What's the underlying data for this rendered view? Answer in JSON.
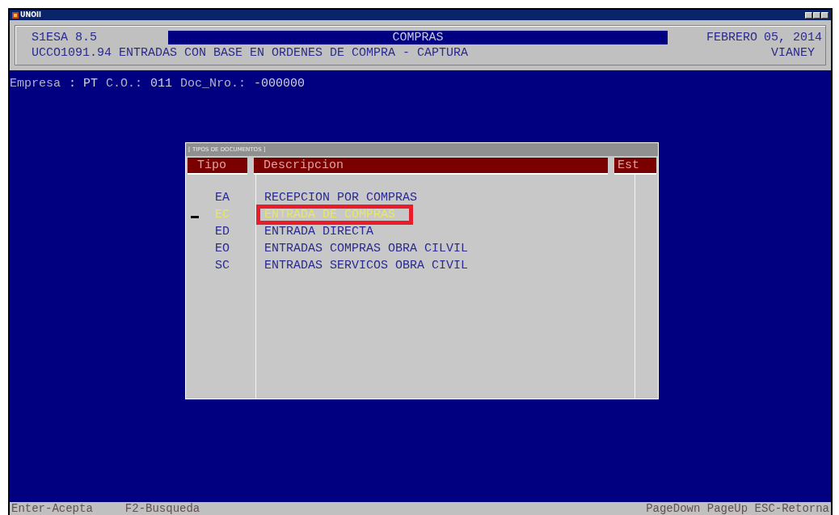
{
  "window": {
    "title": "UNOII"
  },
  "header": {
    "product": "S1ESA 8.5",
    "module": "COMPRAS",
    "date_month": "FEBRERO",
    "date_day": "05, 2014",
    "program": "UCCO1091.94 ENTRADAS CON BASE EN ORDENES DE COMPRA - CAPTURA",
    "user": "VIANEY"
  },
  "fields": [
    {
      "label": "Empresa",
      "value": ": PT"
    },
    {
      "label": "C.O.:",
      "value": "011"
    },
    {
      "label": "Doc_Nro.:",
      "value": "-000000"
    }
  ],
  "dialog": {
    "title": "[ TIPOS DE DOCUMENTOS ]",
    "columns": [
      "Tipo",
      "Descripcion",
      "Est"
    ],
    "rows": [
      {
        "tipo": "EA",
        "descripcion": "RECEPCION POR COMPRAS",
        "selected": false
      },
      {
        "tipo": "EC",
        "descripcion": "ENTRADA DE COMPRAS",
        "selected": true
      },
      {
        "tipo": "ED",
        "descripcion": "ENTRADA DIRECTA",
        "selected": false
      },
      {
        "tipo": "EO",
        "descripcion": "ENTRADAS COMPRAS OBRA CILVIL",
        "selected": false
      },
      {
        "tipo": "SC",
        "descripcion": "ENTRADAS SERVICOS OBRA CIVIL",
        "selected": false
      }
    ]
  },
  "status_bar": {
    "left": [
      "Enter-Acepta",
      "F2-Busqueda"
    ],
    "right": "PageDown PageUp ESC-Retorna"
  }
}
